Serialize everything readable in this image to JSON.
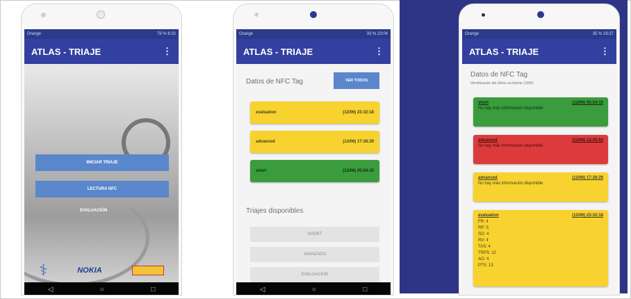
{
  "status": {
    "carrier_1": "Orange",
    "right_1": "79 % 8:32",
    "carrier_2": "Orange",
    "right_2": "33 % 23:04",
    "carrier_3": "Orange",
    "right_3": "35 % 23:37"
  },
  "app_title": "ATLAS - TRIAJE",
  "menu_glyph": "⋮",
  "screen1": {
    "iniciar_label": "INICIAR TRIAJE",
    "lectura_label": "LECTURA NFC",
    "evaluacion_label": "EVALUACIÓN",
    "nokia_logo": "NOKIA"
  },
  "screen2": {
    "section_title": "Datos de NFC Tag",
    "ver_todos": "VER TODOS",
    "entries": [
      {
        "label": "evaluation",
        "time": "(12/06) 23:32:18"
      },
      {
        "label": "advanced",
        "time": "(12/06) 17:28:29"
      },
      {
        "label": "short",
        "time": "(12/06) 05:54:15"
      }
    ],
    "triajes_title": "Triajes disponibles",
    "triajes": [
      "SHORT",
      "AVANZADO",
      "EVALUACIÓN"
    ]
  },
  "screen3": {
    "section_title": "Datos de NFC Tag",
    "subtitle": "Identificación del último accidente (1000)",
    "cards": [
      {
        "label": "short",
        "time": "(12/06) 05:54:15",
        "note": "No hay más información disponible"
      },
      {
        "label": "advanced",
        "time": "(12/06) 12:05:02",
        "note": "No hay más información disponible"
      },
      {
        "label": "advanced",
        "time": "(12/06) 17:28:29",
        "note": "No hay más información disponible"
      }
    ],
    "evaluation": {
      "label": "evaluation",
      "time": "(12/06) 23:32:18",
      "vitals": [
        "FR: 4",
        "RP: 5",
        "SO: 4",
        "RV: 4",
        "TAS: 4",
        "TRPS: 12",
        "AO: 4",
        "PTS: 13"
      ]
    }
  },
  "nav": {
    "back": "◁",
    "home": "○",
    "recents": "□"
  },
  "colors": {
    "primary": "#3340a0",
    "accent": "#5a87cc",
    "yellow": "#f8d22e",
    "green": "#3a9c3d",
    "red": "#dd3b3b",
    "background_blue": "#2e3586"
  }
}
